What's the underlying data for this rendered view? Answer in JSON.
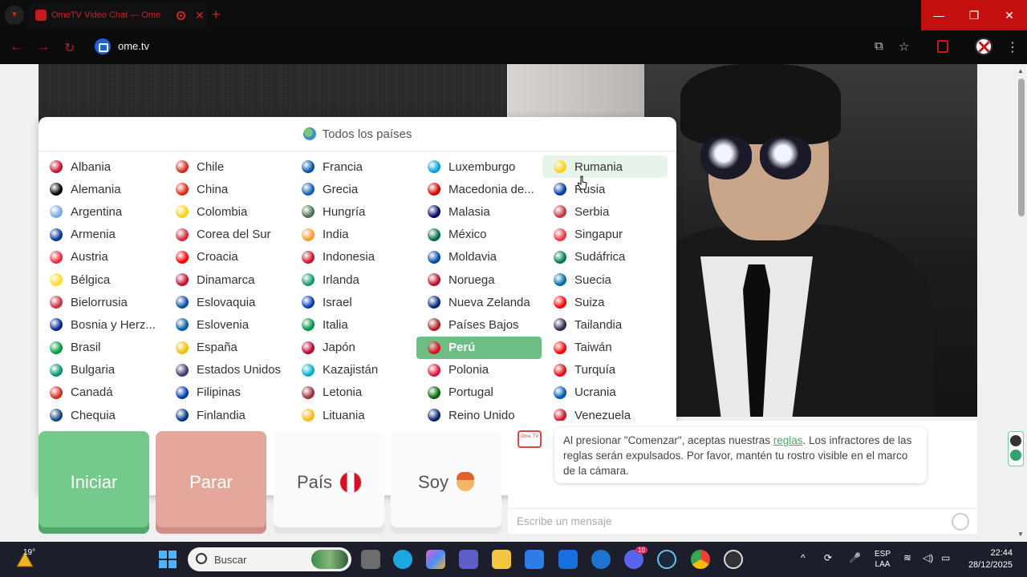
{
  "browser": {
    "tab_title": "OmeTV Video Chat — Ome",
    "new_tab": "+",
    "url": "ome.tv",
    "close_tab": "✕",
    "window_min": "—",
    "window_max": "❐",
    "window_close": "✕"
  },
  "dropdown": {
    "header": "Todos los países",
    "columns": [
      [
        {
          "name": "Albania",
          "color": "#c8102e"
        },
        {
          "name": "Alemania",
          "color": "#000000"
        },
        {
          "name": "Argentina",
          "color": "#74acdf"
        },
        {
          "name": "Armenia",
          "color": "#0033a0"
        },
        {
          "name": "Austria",
          "color": "#ed2939"
        },
        {
          "name": "Bélgica",
          "color": "#fdda24"
        },
        {
          "name": "Bielorrusia",
          "color": "#c8313e"
        },
        {
          "name": "Bosnia y Herz...",
          "color": "#002395"
        },
        {
          "name": "Brasil",
          "color": "#009c3b"
        },
        {
          "name": "Bulgaria",
          "color": "#00966e"
        },
        {
          "name": "Canadá",
          "color": "#d52b1e"
        },
        {
          "name": "Chequia",
          "color": "#11457e"
        }
      ],
      [
        {
          "name": "Chile",
          "color": "#d52b1e"
        },
        {
          "name": "China",
          "color": "#de2910"
        },
        {
          "name": "Colombia",
          "color": "#fcd116"
        },
        {
          "name": "Corea del Sur",
          "color": "#cd2e3a"
        },
        {
          "name": "Croacia",
          "color": "#ff0000"
        },
        {
          "name": "Dinamarca",
          "color": "#c60c30"
        },
        {
          "name": "Eslovaquia",
          "color": "#0b4ea2"
        },
        {
          "name": "Eslovenia",
          "color": "#005da4"
        },
        {
          "name": "España",
          "color": "#f1bf00"
        },
        {
          "name": "Estados Unidos",
          "color": "#3c3b6e"
        },
        {
          "name": "Filipinas",
          "color": "#0038a8"
        },
        {
          "name": "Finlandia",
          "color": "#003580"
        }
      ],
      [
        {
          "name": "Francia",
          "color": "#0055a4"
        },
        {
          "name": "Grecia",
          "color": "#0d5eaf"
        },
        {
          "name": "Hungría",
          "color": "#477050"
        },
        {
          "name": "India",
          "color": "#ff9933"
        },
        {
          "name": "Indonesia",
          "color": "#ce1126"
        },
        {
          "name": "Irlanda",
          "color": "#169b62"
        },
        {
          "name": "Israel",
          "color": "#0038b8"
        },
        {
          "name": "Italia",
          "color": "#009246"
        },
        {
          "name": "Japón",
          "color": "#bc002d"
        },
        {
          "name": "Kazajistán",
          "color": "#00afca"
        },
        {
          "name": "Letonia",
          "color": "#9e3039"
        },
        {
          "name": "Lituania",
          "color": "#fdb913"
        }
      ],
      [
        {
          "name": "Luxemburgo",
          "color": "#00a1de"
        },
        {
          "name": "Macedonia de...",
          "color": "#d20000"
        },
        {
          "name": "Malasia",
          "color": "#010066"
        },
        {
          "name": "México",
          "color": "#006847"
        },
        {
          "name": "Moldavia",
          "color": "#0046ae"
        },
        {
          "name": "Noruega",
          "color": "#ba0c2f"
        },
        {
          "name": "Nueva Zelanda",
          "color": "#00247d"
        },
        {
          "name": "Países Bajos",
          "color": "#ae1c28"
        },
        {
          "name": "Perú",
          "color": "#d91023"
        },
        {
          "name": "Polonia",
          "color": "#dc143c"
        },
        {
          "name": "Portugal",
          "color": "#006600"
        },
        {
          "name": "Reino Unido",
          "color": "#012169"
        }
      ],
      [
        {
          "name": "Rumania",
          "color": "#fcd116"
        },
        {
          "name": "Rusia",
          "color": "#0039a6"
        },
        {
          "name": "Serbia",
          "color": "#c6363c"
        },
        {
          "name": "Singapur",
          "color": "#ef3340"
        },
        {
          "name": "Sudáfrica",
          "color": "#007a4d"
        },
        {
          "name": "Suecia",
          "color": "#006aa7"
        },
        {
          "name": "Suiza",
          "color": "#ff0000"
        },
        {
          "name": "Tailandia",
          "color": "#2d2a4a"
        },
        {
          "name": "Taiwán",
          "color": "#fe0000"
        },
        {
          "name": "Turquía",
          "color": "#e30a17"
        },
        {
          "name": "Ucrania",
          "color": "#0057b7"
        },
        {
          "name": "Venezuela",
          "color": "#cf142b"
        }
      ]
    ],
    "selected": "Perú",
    "hovered": "Rumania"
  },
  "buttons": {
    "start": "Iniciar",
    "stop": "Parar",
    "country": "País",
    "me": "Soy"
  },
  "chat": {
    "logo": "Ome TV",
    "message_before_link": "Al presionar \"Comenzar\", aceptas nuestras ",
    "message_link": "reglas",
    "message_after_link": ". Los infractores de las reglas serán expulsados. Por favor, mantén tu rostro visible en el marco de la cámara.",
    "input_placeholder": "Escribe un mensaje"
  },
  "taskbar": {
    "temperature": "19°",
    "search_label": "Buscar",
    "language_line1": "ESP",
    "language_line2": "LAA",
    "time": "22:44",
    "date": "28/12/2025",
    "steam_badge": "10"
  }
}
